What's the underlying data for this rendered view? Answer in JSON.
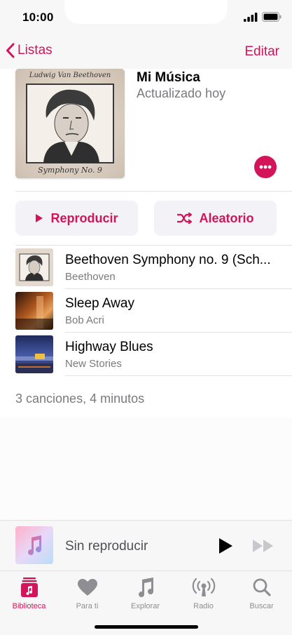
{
  "status": {
    "time": "10:00"
  },
  "nav": {
    "back_label": "Listas",
    "edit_label": "Editar"
  },
  "playlist": {
    "title": "Mi Música",
    "subtitle": "Actualizado hoy",
    "artwork_top_text": "Ludwig Van Beethoven",
    "artwork_bottom_text": "Symphony No. 9"
  },
  "actions": {
    "play_label": "Reproducir",
    "shuffle_label": "Aleatorio"
  },
  "tracks": [
    {
      "title": "Beethoven Symphony no. 9 (Sch...",
      "artist": "Beethoven"
    },
    {
      "title": "Sleep Away",
      "artist": "Bob Acri"
    },
    {
      "title": "Highway Blues",
      "artist": "New Stories"
    }
  ],
  "summary": "3 canciones, 4 minutos",
  "mini_player": {
    "title": "Sin reproducir"
  },
  "tabs": [
    {
      "label": "Biblioteca",
      "icon": "library-icon",
      "active": true
    },
    {
      "label": "Para ti",
      "icon": "heart-icon",
      "active": false
    },
    {
      "label": "Explorar",
      "icon": "music-note-icon",
      "active": false
    },
    {
      "label": "Radio",
      "icon": "radio-icon",
      "active": false
    },
    {
      "label": "Buscar",
      "icon": "search-icon",
      "active": false
    }
  ],
  "colors": {
    "accent": "#d4145a",
    "secondary_text": "#7a7a7e",
    "inactive_tab": "#8e8e93"
  }
}
